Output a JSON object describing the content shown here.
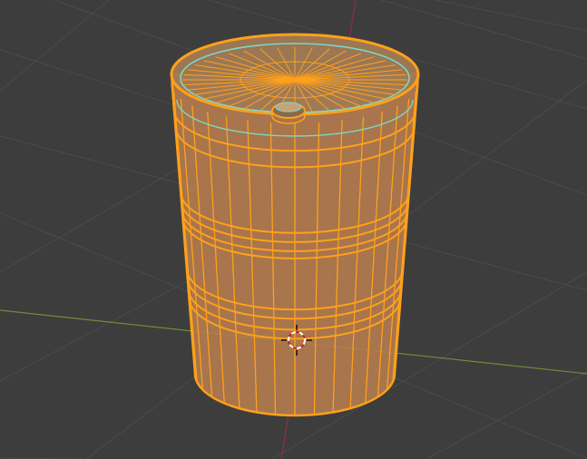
{
  "app": "3D viewport",
  "viewport": {
    "background": "#3d3d3d",
    "grid_color": "#4b4b4b",
    "x_axis_color": "#6e8d3a",
    "y_axis_color": "#8f2f3d"
  },
  "object": {
    "type": "barrel",
    "state": "selected",
    "wire_color": "#ffa11a",
    "fill_color": "#b77d4e",
    "active_edge_color": "#7fd6c2",
    "vertical_segments": 32
  },
  "cursor": {
    "icon": "3d-cursor-icon"
  }
}
